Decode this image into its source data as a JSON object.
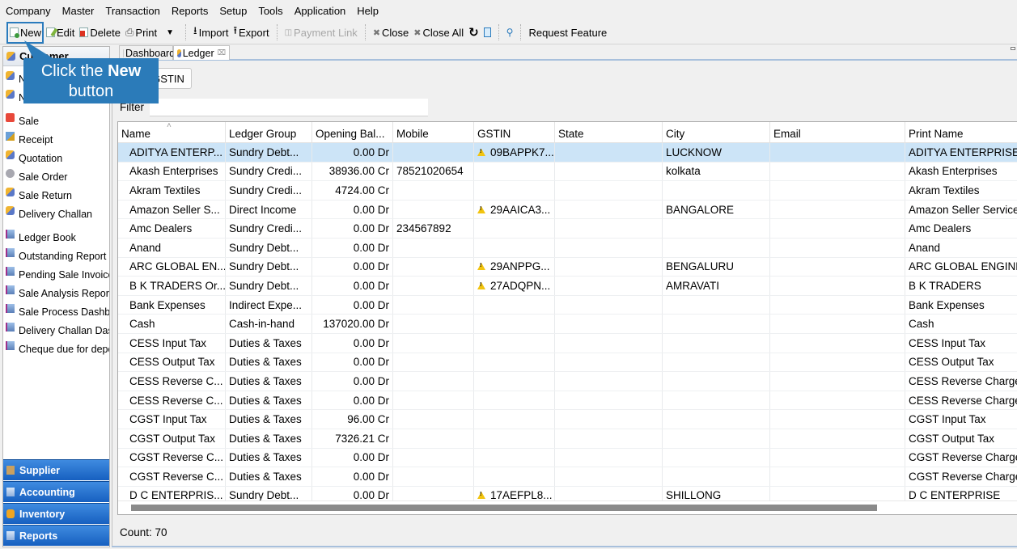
{
  "menubar": [
    "Company",
    "Master",
    "Transaction",
    "Reports",
    "Setup",
    "Tools",
    "Application",
    "Help"
  ],
  "toolbar": {
    "new": "New",
    "edit": "Edit",
    "delete": "Delete",
    "print": "Print",
    "import": "Import",
    "export": "Export",
    "payment_link": "Payment Link",
    "close": "Close",
    "close_all": "Close All",
    "request_feature": "Request Feature"
  },
  "callout": {
    "prefix": "Click the ",
    "bold": "New",
    "suffix": "button"
  },
  "left_panel": {
    "header": "Customer",
    "items": [
      {
        "label": "New Customer",
        "icon": "person-icon"
      },
      {
        "label": "New Ledger",
        "icon": "person-icon"
      },
      {
        "label": "Sale",
        "icon": "sale-icon"
      },
      {
        "label": "Receipt",
        "icon": "receipt-icon"
      },
      {
        "label": "Quotation",
        "icon": "person-icon"
      },
      {
        "label": "Sale Order",
        "icon": "order-icon"
      },
      {
        "label": "Sale Return",
        "icon": "person-icon"
      },
      {
        "label": "Delivery Challan",
        "icon": "person-icon"
      },
      {
        "label": "Ledger Book",
        "icon": "report-icon"
      },
      {
        "label": "Outstanding Report",
        "icon": "report-icon"
      },
      {
        "label": "Pending Sale Invoices",
        "icon": "report-icon"
      },
      {
        "label": "Sale Analysis Report",
        "icon": "report-icon"
      },
      {
        "label": "Sale Process Dashboard",
        "icon": "report-icon"
      },
      {
        "label": "Delivery Challan Dashboard",
        "icon": "report-icon"
      },
      {
        "label": "Cheque due for deposit",
        "icon": "report-icon"
      }
    ],
    "accordions": [
      {
        "label": "Supplier",
        "icon": "supplier-icon"
      },
      {
        "label": "Accounting",
        "icon": "report-icon"
      },
      {
        "label": "Inventory",
        "icon": "inventory-icon"
      },
      {
        "label": "Reports",
        "icon": "report-icon"
      }
    ]
  },
  "tabs": [
    {
      "label": "Dashboard",
      "active": false
    },
    {
      "label": "Ledger",
      "active": true,
      "closable": true
    }
  ],
  "ledger": {
    "gstin_button": "GSTIN",
    "filter_label": "Filter",
    "filter_value": "",
    "columns": [
      "Name",
      "Ledger Group",
      "Opening Bal...",
      "Mobile",
      "GSTIN",
      "State",
      "City",
      "Email",
      "Print Name"
    ],
    "rows": [
      {
        "name": "ADITYA ENTERP...",
        "group": "Sundry Debt...",
        "opening": "0.00 Dr",
        "mobile": "",
        "gstin": "09BAPPK7...",
        "gstin_warn": true,
        "state": "",
        "city": "LUCKNOW",
        "email": "",
        "print_name": "ADITYA ENTERPRISES",
        "selected": true
      },
      {
        "name": "Akash Enterprises",
        "group": "Sundry Credi...",
        "opening": "38936.00 Cr",
        "mobile": "78521020654",
        "gstin": "",
        "gstin_warn": false,
        "state": "",
        "city": "kolkata",
        "email": "",
        "print_name": "Akash Enterprises"
      },
      {
        "name": "Akram Textiles",
        "group": "Sundry Credi...",
        "opening": "4724.00 Cr",
        "mobile": "",
        "gstin": "",
        "gstin_warn": false,
        "state": "",
        "city": "",
        "email": "",
        "print_name": "Akram Textiles"
      },
      {
        "name": "Amazon Seller S...",
        "group": "Direct Income",
        "opening": "0.00 Dr",
        "mobile": "",
        "gstin": "29AAICA3...",
        "gstin_warn": true,
        "state": "",
        "city": "BANGALORE",
        "email": "",
        "print_name": "Amazon Seller Services"
      },
      {
        "name": "Amc Dealers",
        "group": "Sundry Credi...",
        "opening": "0.00 Dr",
        "mobile": "234567892",
        "gstin": "",
        "gstin_warn": false,
        "state": "",
        "city": "",
        "email": "",
        "print_name": "Amc Dealers"
      },
      {
        "name": "Anand",
        "group": "Sundry Debt...",
        "opening": "0.00 Dr",
        "mobile": "",
        "gstin": "",
        "gstin_warn": false,
        "state": "",
        "city": "",
        "email": "",
        "print_name": "Anand"
      },
      {
        "name": "ARC GLOBAL EN...",
        "group": "Sundry Debt...",
        "opening": "0.00 Dr",
        "mobile": "",
        "gstin": "29ANPPG...",
        "gstin_warn": true,
        "state": "",
        "city": "BENGALURU",
        "email": "",
        "print_name": "ARC GLOBAL ENGINEERING"
      },
      {
        "name": "B K TRADERS Or...",
        "group": "Sundry Debt...",
        "opening": "0.00 Dr",
        "mobile": "",
        "gstin": "27ADQPN...",
        "gstin_warn": true,
        "state": "",
        "city": "AMRAVATI",
        "email": "",
        "print_name": "B K TRADERS"
      },
      {
        "name": "Bank Expenses",
        "group": "Indirect Expe...",
        "opening": "0.00 Dr",
        "mobile": "",
        "gstin": "",
        "gstin_warn": false,
        "state": "",
        "city": "",
        "email": "",
        "print_name": "Bank Expenses"
      },
      {
        "name": "Cash",
        "group": "Cash-in-hand",
        "opening": "137020.00 Dr",
        "mobile": "",
        "gstin": "",
        "gstin_warn": false,
        "state": "",
        "city": "",
        "email": "",
        "print_name": "Cash"
      },
      {
        "name": "CESS Input Tax",
        "group": "Duties & Taxes",
        "opening": "0.00 Dr",
        "mobile": "",
        "gstin": "",
        "gstin_warn": false,
        "state": "",
        "city": "",
        "email": "",
        "print_name": "CESS Input Tax"
      },
      {
        "name": "CESS Output Tax",
        "group": "Duties & Taxes",
        "opening": "0.00 Dr",
        "mobile": "",
        "gstin": "",
        "gstin_warn": false,
        "state": "",
        "city": "",
        "email": "",
        "print_name": "CESS Output Tax"
      },
      {
        "name": "CESS Reverse C...",
        "group": "Duties & Taxes",
        "opening": "0.00 Dr",
        "mobile": "",
        "gstin": "",
        "gstin_warn": false,
        "state": "",
        "city": "",
        "email": "",
        "print_name": "CESS Reverse Charge"
      },
      {
        "name": "CESS Reverse C...",
        "group": "Duties & Taxes",
        "opening": "0.00 Dr",
        "mobile": "",
        "gstin": "",
        "gstin_warn": false,
        "state": "",
        "city": "",
        "email": "",
        "print_name": "CESS Reverse Charge"
      },
      {
        "name": "CGST Input Tax",
        "group": "Duties & Taxes",
        "opening": "96.00 Cr",
        "mobile": "",
        "gstin": "",
        "gstin_warn": false,
        "state": "",
        "city": "",
        "email": "",
        "print_name": "CGST Input Tax"
      },
      {
        "name": "CGST Output Tax",
        "group": "Duties & Taxes",
        "opening": "7326.21 Cr",
        "mobile": "",
        "gstin": "",
        "gstin_warn": false,
        "state": "",
        "city": "",
        "email": "",
        "print_name": "CGST Output Tax"
      },
      {
        "name": "CGST Reverse C...",
        "group": "Duties & Taxes",
        "opening": "0.00 Dr",
        "mobile": "",
        "gstin": "",
        "gstin_warn": false,
        "state": "",
        "city": "",
        "email": "",
        "print_name": "CGST Reverse Charge"
      },
      {
        "name": "CGST Reverse C...",
        "group": "Duties & Taxes",
        "opening": "0.00 Dr",
        "mobile": "",
        "gstin": "",
        "gstin_warn": false,
        "state": "",
        "city": "",
        "email": "",
        "print_name": "CGST Reverse Charge"
      },
      {
        "name": "D C ENTERPRIS...",
        "group": "Sundry Debt...",
        "opening": "0.00 Dr",
        "mobile": "",
        "gstin": "17AEFPL8...",
        "gstin_warn": true,
        "state": "",
        "city": "SHILLONG",
        "email": "",
        "print_name": "D C ENTERPRISE"
      }
    ],
    "count_label": "Count: 70"
  },
  "colors": {
    "accent": "#2b7bb9",
    "selected_row": "#cce4f7",
    "accordion": "#1f6fd0",
    "warning": "#f2c40f"
  }
}
